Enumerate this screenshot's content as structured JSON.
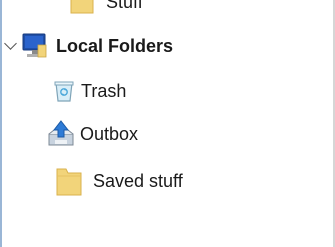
{
  "folder_tree": {
    "partial_item": {
      "label": "Stuff",
      "icon": "folder-icon"
    },
    "account": {
      "label": "Local Folders",
      "icon": "computer-monitor-icon",
      "expanded": true
    },
    "folders": [
      {
        "label": "Trash",
        "icon": "trash-icon"
      },
      {
        "label": "Outbox",
        "icon": "outbox-icon"
      },
      {
        "label": "Saved stuff",
        "icon": "folder-icon"
      }
    ]
  },
  "colors": {
    "folder_yellow": "#f2d47a",
    "selection_border": "#9ab6d6",
    "monitor_blue": "#1f4fa8"
  }
}
